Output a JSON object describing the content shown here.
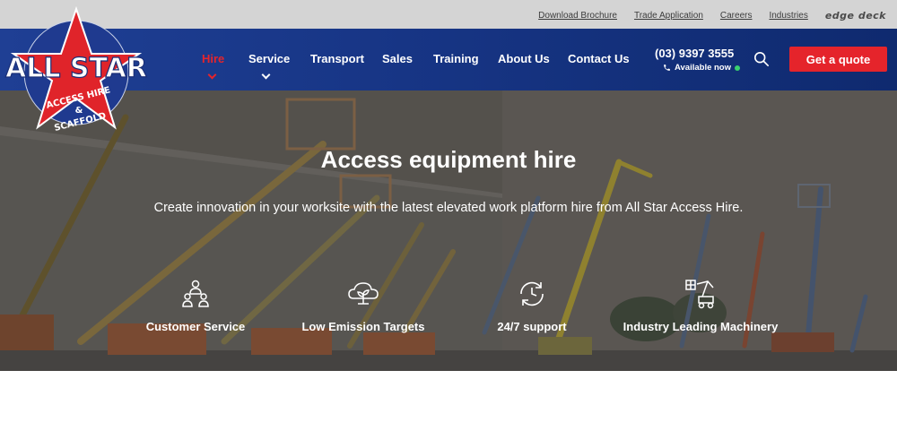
{
  "topbar": {
    "links": [
      "Download Brochure",
      "Trade Application",
      "Careers",
      "Industries"
    ],
    "partner_logo": "edge deck"
  },
  "logo": {
    "line1": "ALL STAR",
    "line2": "ACCESS HIRE",
    "line3": "&",
    "line4": "SCAFFOLD"
  },
  "nav": {
    "items": [
      {
        "label": "Hire",
        "active": true,
        "has_dropdown": true
      },
      {
        "label": "Service",
        "active": false,
        "has_dropdown": true
      },
      {
        "label": "Transport"
      },
      {
        "label": "Sales"
      },
      {
        "label": "Training"
      },
      {
        "label": "About Us"
      },
      {
        "label": "Contact Us"
      }
    ],
    "phone": "(03) 9397 3555",
    "availability": "Available now",
    "cta": "Get a quote",
    "icons": {
      "search": "search-icon",
      "phone": "phone-icon"
    }
  },
  "hero": {
    "title": "Access equipment hire",
    "subtitle": "Create innovation in your worksite with the latest elevated work platform hire from All Star Access Hire.",
    "features": [
      {
        "label": "Customer Service",
        "icon": "team-icon"
      },
      {
        "label": "Low Emission Targets",
        "icon": "cloud-plant-icon"
      },
      {
        "label": "24/7 support",
        "icon": "clock-cycle-icon"
      },
      {
        "label": "Industry Leading Machinery",
        "icon": "machinery-icon"
      }
    ]
  },
  "colors": {
    "brand_blue": "#173585",
    "accent_red": "#e5242b",
    "topbar_gray": "#d4d4d4",
    "available_green": "#3ad06e"
  }
}
